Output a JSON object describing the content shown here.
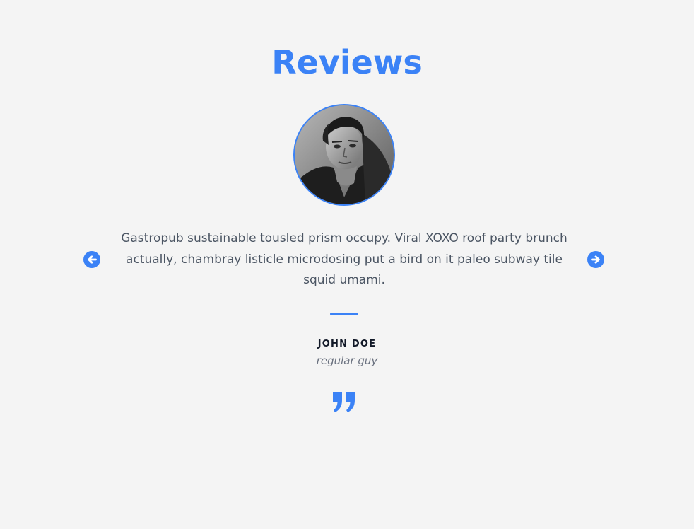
{
  "section": {
    "title": "Reviews"
  },
  "review": {
    "text": "Gastropub sustainable tousled prism occupy. Viral XOXO roof party brunch actually, chambray listicle microdosing put a bird on it paleo subway tile squid umami.",
    "name": "JOHN DOE",
    "role": "regular guy"
  },
  "icons": {
    "prev": "arrow-left-circle-icon",
    "next": "arrow-right-circle-icon",
    "quote": "quote-icon"
  },
  "colors": {
    "accent": "#3b82f6",
    "background": "#f4f4f4",
    "text": "#4b5563"
  }
}
